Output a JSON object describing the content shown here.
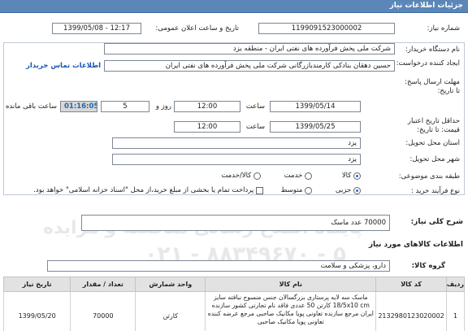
{
  "header": {
    "title": "جزئیات اطلاعات نیاز"
  },
  "form": {
    "need_number_label": "شماره نیاز:",
    "need_number": "1199091523000002",
    "announce_label": "تاریخ و ساعت اعلان عمومی:",
    "announce_value": "1399/05/08 - 12:17",
    "buyer_label": "نام دستگاه خریدار:",
    "buyer_value": "شرکت ملی پخش فرآورده های نفتی ایران - منطقه یزد",
    "creator_label": "ایجاد کننده درخواست:",
    "creator_value": "حسین دهقان بنادکی کارمندبازرگانی  شرکت ملی پخش فرآورده های نفتی ایران",
    "contact_link": "اطلاعات تماس خریدار",
    "reply_deadline_label": "مهلت ارسال پاسخ:",
    "reply_deadline_sub": "تا تاریخ:",
    "reply_date": "1399/05/14",
    "reply_time_label": "ساعت",
    "reply_time": "12:00",
    "days_value": "5",
    "days_label": "روز و",
    "remaining_time": "01:16:05",
    "remaining_label": "ساعت باقی مانده",
    "min_validity_label": "حداقل تاریخ اعتبار",
    "min_validity_label2": "قیمت: تا تاریخ:",
    "validity_date": "1399/05/25",
    "validity_time_label": "ساعت",
    "validity_time": "12:00",
    "province_label": "استان محل تحویل:",
    "province_value": "یزد",
    "city_label": "شهر محل تحویل:",
    "city_value": "یزد",
    "category_label": "طبقه بندی موضوعی:",
    "category_options": [
      "کالا",
      "خدمت",
      "کالا/خدمت"
    ],
    "process_label": "نوع فرآیند خرید :",
    "process_options": [
      "جزیی",
      "متوسط"
    ],
    "payment_note": "پرداخت تمام یا بخشی از مبلغ خرید،از محل \"اسناد خزانه اسلامی\" خواهد بود."
  },
  "summary": {
    "label": "شرح کلی نیاز:",
    "value": "70000 عدد ماسک"
  },
  "goods": {
    "section_title": "اطلاعات کالاهای مورد نیاز",
    "group_label": "گروه کالا:",
    "group_value": "دارو، پزشکی و سلامت"
  },
  "table": {
    "headers": [
      "ردیف",
      "کد کالا",
      "نام کالا",
      "واحد شمارش",
      "تعداد / مقدار",
      "تاریخ نیاز"
    ],
    "rows": [
      {
        "row": "1",
        "code": "2132980123020002",
        "name": "ماسک سه لایه پرستاری بزرگسالان جنس منسوج نبافته سایز 18/5x10 cm کارتن 50 عددی فاقد نام تجارتی کشور سازنده ایران مرجع سازنده تعاونی پویا مکانیک صاحبی مرجع عرضه کننده تعاونی پویا مکانیک صاحبی",
        "unit": "کارتن",
        "qty": "70000",
        "date": "1399/05/20"
      }
    ]
  },
  "watermark": {
    "line1": "پایگاه اطلاع رسانی مناقصه و مزایده",
    "line2": "۰۲۱ - ۸۸۳۴۹۶۷۰ - ۵"
  },
  "colors": {
    "header_bg": "#5b86b8",
    "link": "#1a56b8",
    "remaining_text": "#2266aa"
  }
}
